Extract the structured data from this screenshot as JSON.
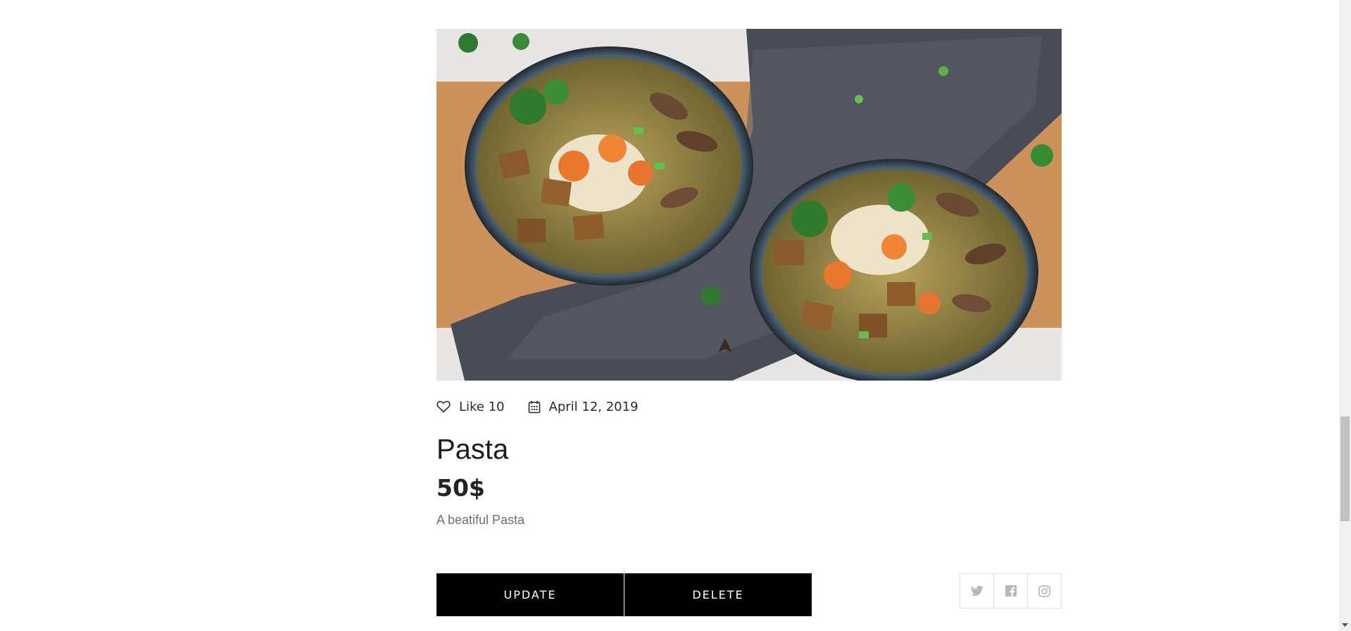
{
  "post": {
    "image_alt": "Two bowls of noodle soup with tofu, carrots, mushrooms and greens",
    "likes_label": "Like 10",
    "date": "April 12, 2019",
    "title": "Pasta",
    "price": "50$",
    "description": "A beatiful Pasta"
  },
  "actions": {
    "update_label": "UPDATE",
    "delete_label": "DELETE"
  },
  "social": {
    "items": [
      "twitter-icon",
      "facebook-icon",
      "instagram-icon"
    ]
  },
  "colors": {
    "button_bg": "#000000",
    "button_text": "#ffffff",
    "social_icon": "#b9b9b9",
    "text_muted": "#6f6f6f"
  }
}
